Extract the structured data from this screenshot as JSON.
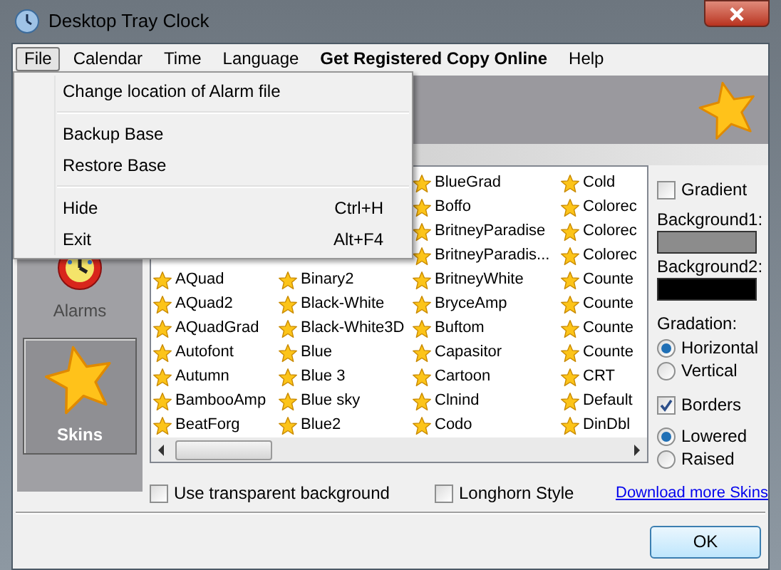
{
  "window": {
    "title": "Desktop Tray Clock"
  },
  "menu_bar": [
    {
      "label": "File",
      "selected": true,
      "bold": false
    },
    {
      "label": "Calendar",
      "selected": false,
      "bold": false
    },
    {
      "label": "Time",
      "selected": false,
      "bold": false
    },
    {
      "label": "Language",
      "selected": false,
      "bold": false
    },
    {
      "label": "Get Registered Copy Online",
      "selected": false,
      "bold": true
    },
    {
      "label": "Help",
      "selected": false,
      "bold": false
    }
  ],
  "file_menu": [
    [
      {
        "label": "Change location of Alarm file"
      }
    ],
    [
      {
        "label": "Backup Base"
      },
      {
        "label": "Restore Base"
      }
    ],
    [
      {
        "label": "Hide",
        "shortcut": "Ctrl+H"
      },
      {
        "label": "Exit",
        "shortcut": "Alt+F4"
      }
    ]
  ],
  "sidebar": [
    {
      "label": "Alarms",
      "kind": "clock",
      "selected": false
    },
    {
      "label": "Skins",
      "kind": "star",
      "selected": true
    }
  ],
  "skins": {
    "columns": [
      {
        "items": [
          "AQuad",
          "AQuad2",
          "AQuadGrad",
          "Autofont",
          "Autumn",
          "BambooAmp",
          "BeatForg"
        ]
      },
      {
        "items": [
          "Binary2",
          "Black-White",
          "Black-White3D",
          "Blue",
          "Blue 3",
          "Blue sky",
          "Blue2"
        ]
      },
      {
        "items": [
          "BlueGrad",
          "Boffo",
          "BritneyParadise",
          "BritneyParadis...",
          "BritneyWhite",
          "BryceAmp",
          "Buftom",
          "Capasitor",
          "Cartoon",
          "Clnind",
          "Codo"
        ]
      },
      {
        "items": [
          "Cold",
          "Colorec",
          "Colorec",
          "Colorec",
          "Counte",
          "Counte",
          "Counte",
          "Counte",
          "CRT",
          "Default",
          "DinDbl"
        ]
      }
    ]
  },
  "options": [
    {
      "kind": "checkbox",
      "label": "Gradient",
      "checked": false
    },
    {
      "kind": "swatch",
      "label": "Background1:",
      "color": "#8c8c8c"
    },
    {
      "kind": "swatch",
      "label": "Background2:",
      "color": "#000000"
    },
    {
      "kind": "heading",
      "label": "Gradation:"
    },
    {
      "kind": "radio",
      "label": "Horizontal",
      "selected": true
    },
    {
      "kind": "radio",
      "label": "Vertical",
      "selected": false
    },
    {
      "kind": "gap"
    },
    {
      "kind": "checkbox",
      "label": "Borders",
      "checked": true
    },
    {
      "kind": "radio",
      "label": "Lowered",
      "selected": true
    },
    {
      "kind": "radio",
      "label": "Raised",
      "selected": false
    }
  ],
  "bottom": {
    "transparent_background": {
      "label": "Use transparent background",
      "checked": false
    },
    "longhorn_style": {
      "label": "Longhorn Style",
      "checked": false
    },
    "download_link": "Download more Skins"
  },
  "ok_button": "OK"
}
